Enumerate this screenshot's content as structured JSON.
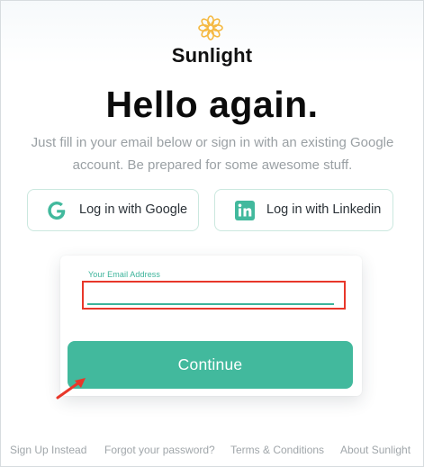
{
  "brand": {
    "name": "Sunlight",
    "logo_icon": "sunflower-icon",
    "logo_color": "#f5b942"
  },
  "headline": "Hello again.",
  "subtitle": "Just fill in your email below or sign in with an existing Google account. Be prepared for some awesome stuff.",
  "social": {
    "google": {
      "label": "Log in with Google",
      "icon": "google-icon"
    },
    "linkedin": {
      "label": "Log in with Linkedin",
      "icon": "linkedin-icon"
    }
  },
  "form": {
    "email_label": "Your Email Address",
    "email_value": "",
    "continue_label": "Continue"
  },
  "footer": {
    "links": [
      "Sign Up Instead",
      "Forgot your password?",
      "Terms & Conditions",
      "About Sunlight"
    ]
  },
  "colors": {
    "accent": "#42b99d",
    "highlight": "#e8372a"
  }
}
